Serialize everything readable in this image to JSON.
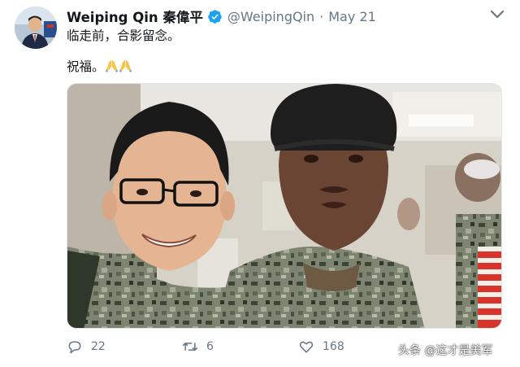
{
  "tweet": {
    "author": {
      "display_name": "Weiping Qin 秦偉平",
      "handle": "@WeipingQin",
      "verified": true,
      "avatar_icon": "avatar-photo"
    },
    "separator": "·",
    "date": "May 21",
    "text_lines": [
      "临走前，合影留念。",
      "祝福。"
    ],
    "emoji": [
      "folded-hands",
      "folded-hands"
    ],
    "menu_icon": "chevron-down-icon",
    "photo_icon": "photo-two-men-in-uniform",
    "actions": {
      "reply_count": "22",
      "retweet_count": "6",
      "like_count": "168"
    }
  },
  "watermark": "头条 @这才是美军",
  "colors": {
    "verified_blue": "#1da1f2",
    "muted_text": "#657786",
    "main_text": "#14171a"
  }
}
